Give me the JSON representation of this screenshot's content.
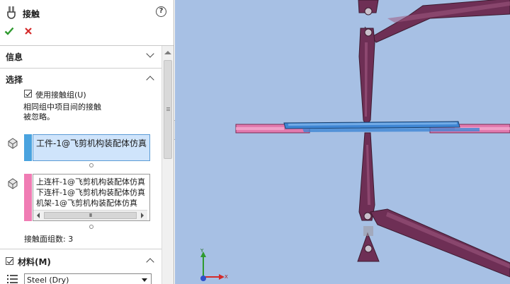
{
  "window": {
    "title": "接触",
    "help_symbol": "?"
  },
  "groups": {
    "info": {
      "title": "信息"
    },
    "selection": {
      "title": "选择",
      "use_contact_group": {
        "label": "使用接触组(U)",
        "checked": true
      },
      "note_lines": [
        "相同组中项目间的接触",
        "被忽略。"
      ],
      "set1": {
        "items": [
          "工件-1@飞剪机构装配体仿真"
        ],
        "color": "#4aa3df"
      },
      "set2": {
        "items": [
          "上连杆-1@飞剪机构装配体仿真",
          "下连杆-1@飞剪机构装配体仿真",
          "机架-1@飞剪机构装配体仿真"
        ],
        "color": "#f07cb4"
      },
      "scrollbar_grip": "III",
      "contact_face_count": "接触面组数: 3"
    },
    "material": {
      "title": "材料(M)",
      "checked": true,
      "selected": "Steel (Dry)"
    }
  },
  "colors": {
    "viewport_bg": "#a7c0e4",
    "linkage": "#6e2f55",
    "linkage_light": "#a15a82",
    "blade_pink": "#e27aae",
    "workpiece_blue": "#3f86d4",
    "ok_green": "#2f9a2f",
    "cancel_red": "#d42a2a"
  },
  "triad": {
    "x_label": "X",
    "y_label": "Y"
  }
}
